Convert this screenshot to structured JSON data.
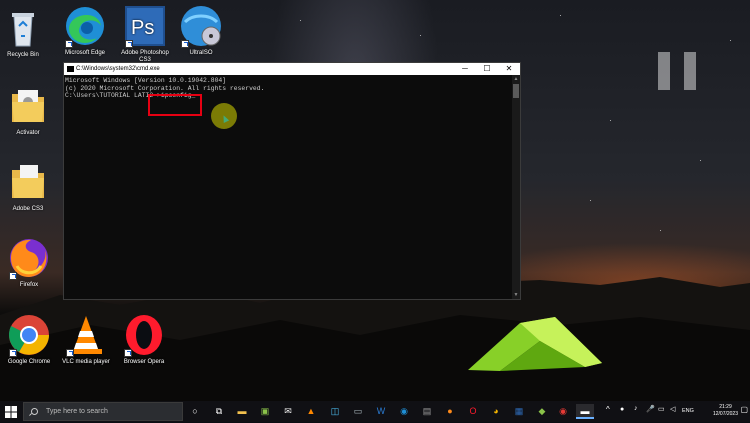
{
  "desktop": {
    "icons": [
      {
        "label": "Recycle Bin"
      },
      {
        "label": "Microsoft Edge"
      },
      {
        "label": "Adobe Photoshop CS3"
      },
      {
        "label": "UltraISO"
      },
      {
        "label": "Activator"
      },
      {
        "label": "Adobe CS3"
      },
      {
        "label": "Firefox"
      },
      {
        "label": "Google Chrome"
      },
      {
        "label": "VLC media player"
      },
      {
        "label": "Browser Opera"
      }
    ]
  },
  "cmd_window": {
    "title": "C:\\Windows\\system32\\cmd.exe",
    "lines": [
      "Microsoft Windows [Version 10.0.19042.804]",
      "(c) 2020 Microsoft Corporation. All rights reserved.",
      "",
      "C:\\Users\\TUTORIAL LATI2 >ipconfig_"
    ],
    "minimize": "─",
    "maximize": "☐",
    "close": "✕"
  },
  "taskbar": {
    "search_placeholder": "Type here to search",
    "language": "ENG",
    "time": "21:29",
    "date": "12/07/2023"
  },
  "colors": {
    "highlight_box": "#e60012",
    "taskbar": "#101014"
  }
}
